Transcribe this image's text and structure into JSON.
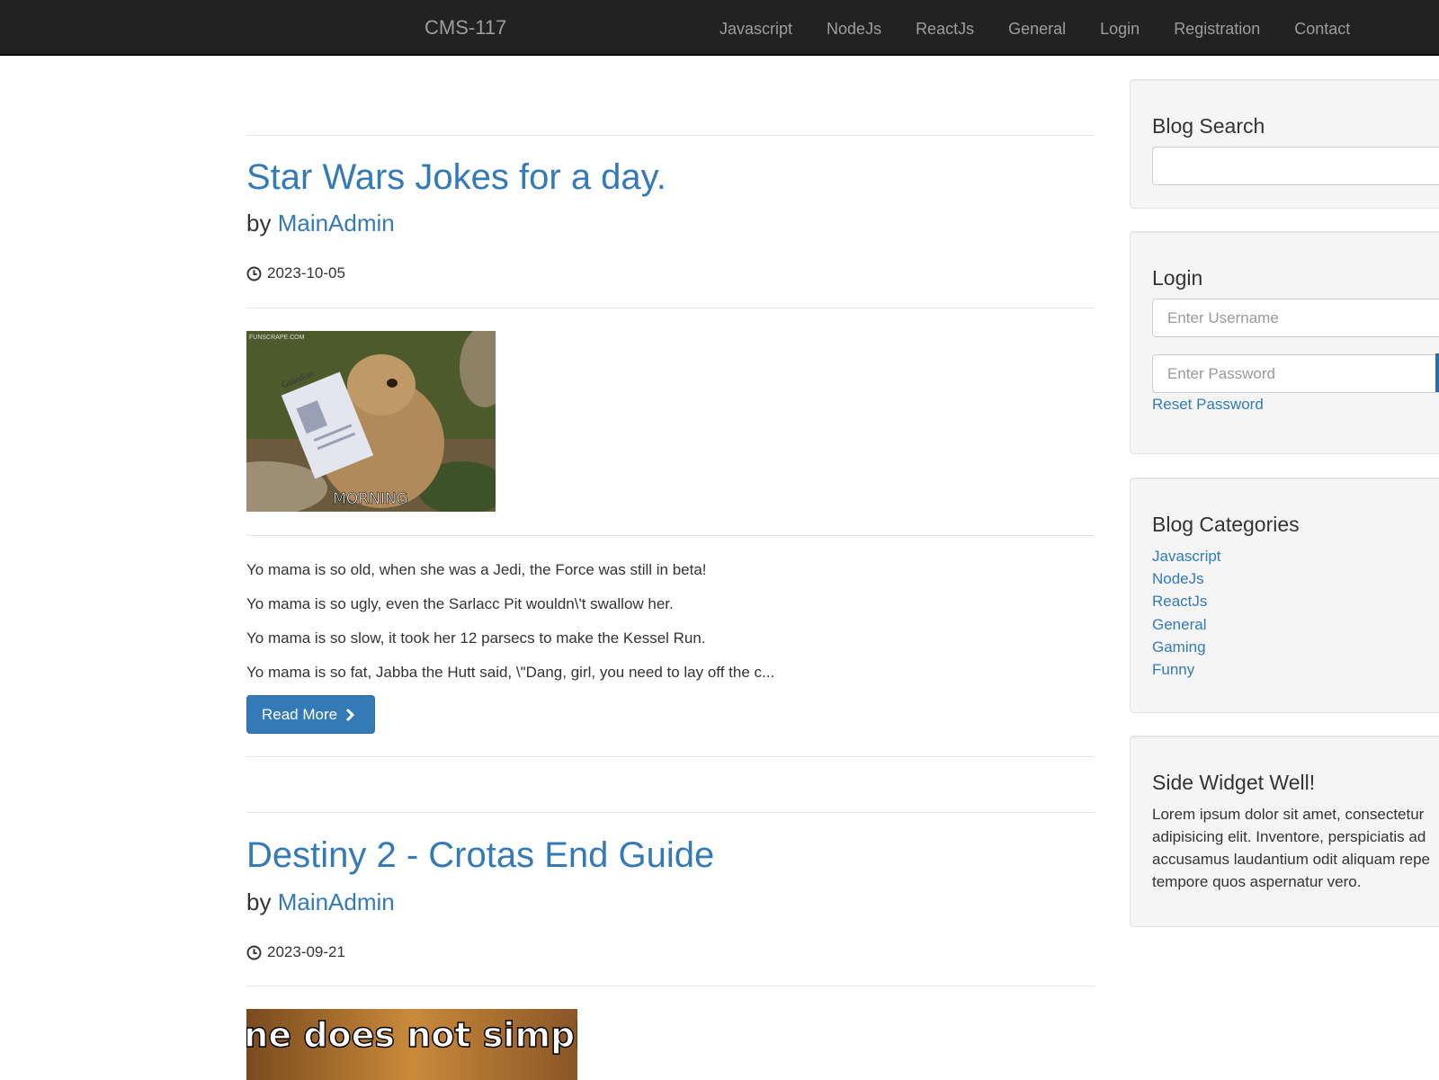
{
  "navbar": {
    "brand": "CMS-117",
    "links": [
      "Javascript",
      "NodeJs",
      "ReactJs",
      "General",
      "Login",
      "Registration",
      "Contact"
    ]
  },
  "posts": [
    {
      "title": "Star Wars Jokes for a day.",
      "by": "by",
      "author": "MainAdmin",
      "date": "2023-10-05",
      "image_caption": "MORNING",
      "image_watermark": "FUNSCRAPE.COM",
      "image_newspaper": "Guardian",
      "excerpt": [
        "Yo mama is so old, when she was a Jedi, the Force was still in beta!",
        "Yo mama is so ugly, even the Sarlacc Pit wouldn\\'t swallow her.",
        "Yo mama is so slow, it took her 12 parsecs to make the Kessel Run.",
        "Yo mama is so fat, Jabba the Hutt said, \\\"Dang, girl, you need to lay off the c..."
      ],
      "read_more": "Read More"
    },
    {
      "title": "Destiny 2 - Crotas End Guide",
      "by": "by",
      "author": "MainAdmin",
      "date": "2023-09-21",
      "image_text": "One does not simply"
    }
  ],
  "sidebar": {
    "search": {
      "title": "Blog Search",
      "value": ""
    },
    "login": {
      "title": "Login",
      "username_placeholder": "Enter Username",
      "password_placeholder": "Enter Password",
      "reset_link": "Reset Password"
    },
    "categories": {
      "title": "Blog Categories",
      "items": [
        "Javascript",
        "NodeJs",
        "ReactJs",
        "General",
        "Gaming",
        "Funny"
      ]
    },
    "widget": {
      "title": "Side Widget Well!",
      "lines": [
        "Lorem ipsum dolor sit amet, consectetur",
        "adipisicing elit. Inventore, perspiciatis ad",
        "accusamus laudantium odit aliquam repe",
        "tempore quos aspernatur vero."
      ]
    }
  },
  "colors": {
    "navbar_bg": "#222222",
    "link": "#337ab7",
    "well_bg": "#f5f5f5"
  },
  "icons": {
    "date": "clock-icon",
    "read_more": "chevron-right-icon"
  }
}
